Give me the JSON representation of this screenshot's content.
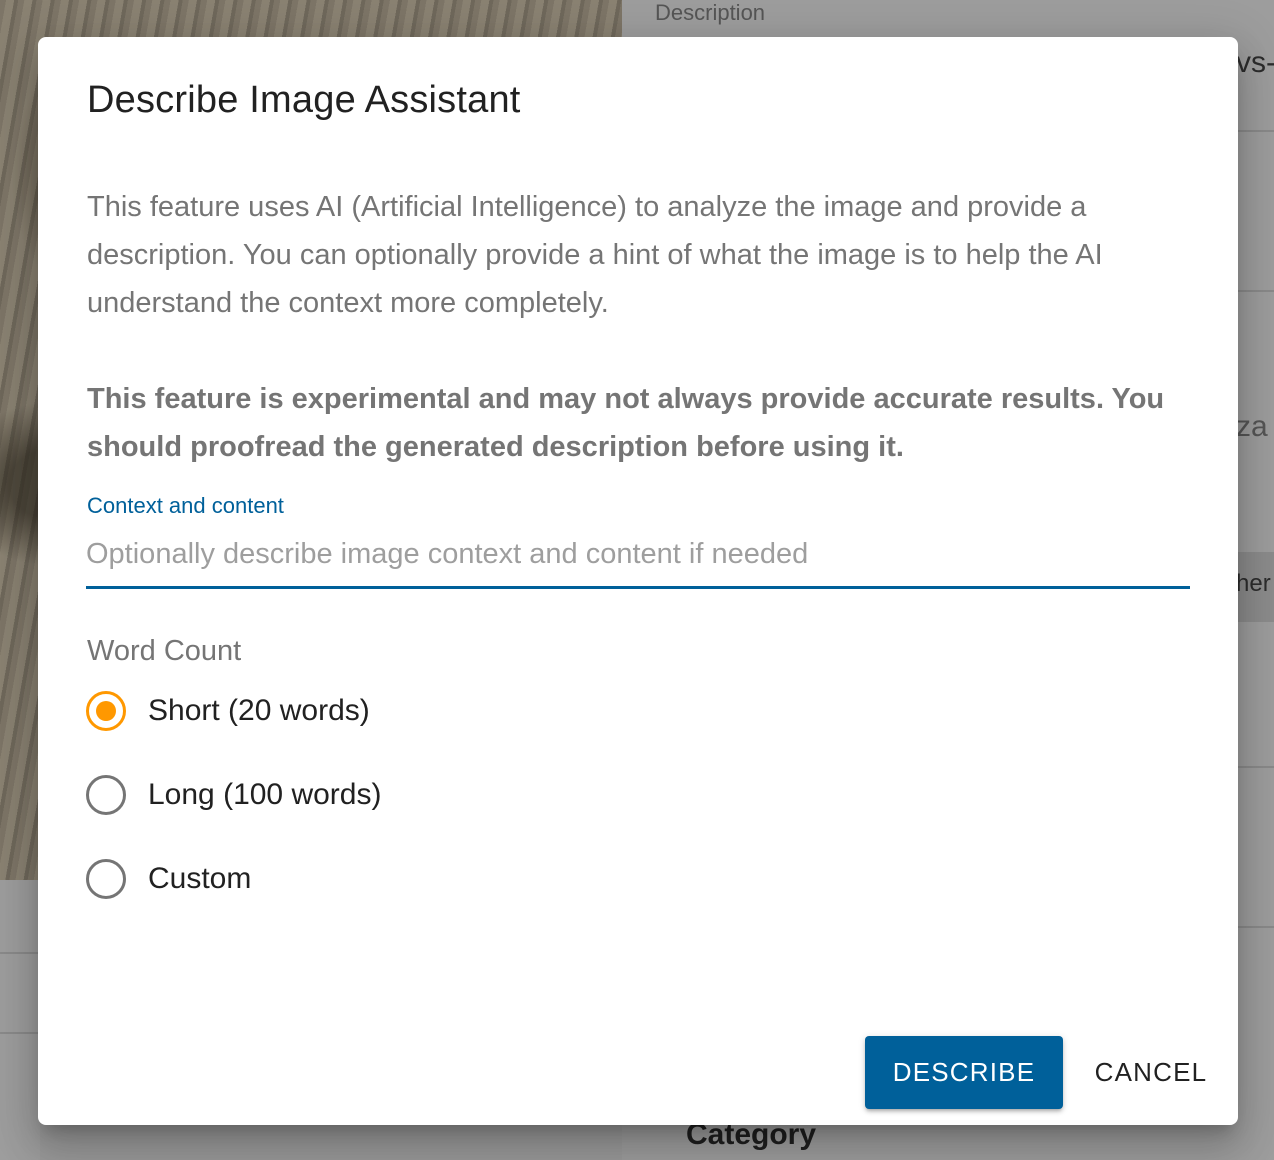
{
  "background": {
    "description_label": "Description",
    "fragment_top": "vs-",
    "fragment_mid": "za",
    "fragment_tab": "her",
    "category_label": "Category"
  },
  "dialog": {
    "title": "Describe Image Assistant",
    "intro": "This feature uses AI (Artificial Intelligence) to analyze the image and provide a description. You can optionally provide a hint of what the image is to help the AI understand the context more completely.",
    "warning": "This feature is experimental and may not always provide accurate results. You should proofread the generated description before using it.",
    "context_field": {
      "label": "Context and content",
      "placeholder": "Optionally describe image context and content if needed",
      "value": ""
    },
    "word_count": {
      "label": "Word Count",
      "options": [
        {
          "label": "Short (20 words)",
          "selected": true
        },
        {
          "label": "Long (100 words)",
          "selected": false
        },
        {
          "label": "Custom",
          "selected": false
        }
      ]
    },
    "buttons": {
      "describe": "DESCRIBE",
      "cancel": "CANCEL"
    }
  },
  "colors": {
    "primary": "#00609a",
    "radio_selected": "#ff9800",
    "radio_unselected": "#757575",
    "muted_text": "#757575"
  }
}
